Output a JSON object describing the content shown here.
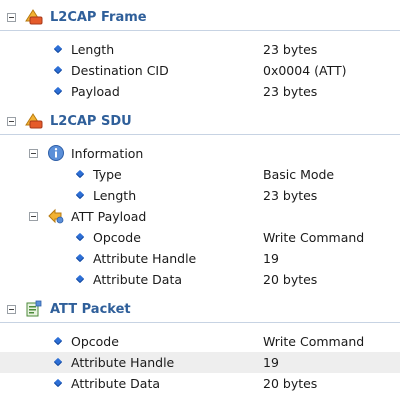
{
  "sections": [
    {
      "title": "L2CAP Frame",
      "icon": "frame-icon",
      "rows": [
        {
          "label": "Length",
          "value": "23 bytes"
        },
        {
          "label": "Destination CID",
          "value": "0x0004 (ATT)"
        },
        {
          "label": "Payload",
          "value": "23 bytes"
        }
      ]
    },
    {
      "title": "L2CAP SDU",
      "icon": "sdu-icon",
      "groups": [
        {
          "label": "Information",
          "icon": "info-icon",
          "rows": [
            {
              "label": "Type",
              "value": "Basic Mode"
            },
            {
              "label": "Length",
              "value": "23 bytes"
            }
          ]
        },
        {
          "label": "ATT Payload",
          "icon": "payload-icon",
          "rows": [
            {
              "label": "Opcode",
              "value": "Write Command"
            },
            {
              "label": "Attribute Handle",
              "value": "19"
            },
            {
              "label": "Attribute Data",
              "value": "20 bytes"
            }
          ]
        }
      ]
    },
    {
      "title": "ATT Packet",
      "icon": "packet-icon",
      "rows": [
        {
          "label": "Opcode",
          "value": "Write Command"
        },
        {
          "label": "Attribute Handle",
          "value": "19",
          "selected": true
        },
        {
          "label": "Attribute Data",
          "value": "20 bytes"
        }
      ]
    }
  ],
  "colors": {
    "section_title": "#2f5f9a",
    "diamond": "#2d6fd6",
    "selected_row": "#eeeeee"
  }
}
